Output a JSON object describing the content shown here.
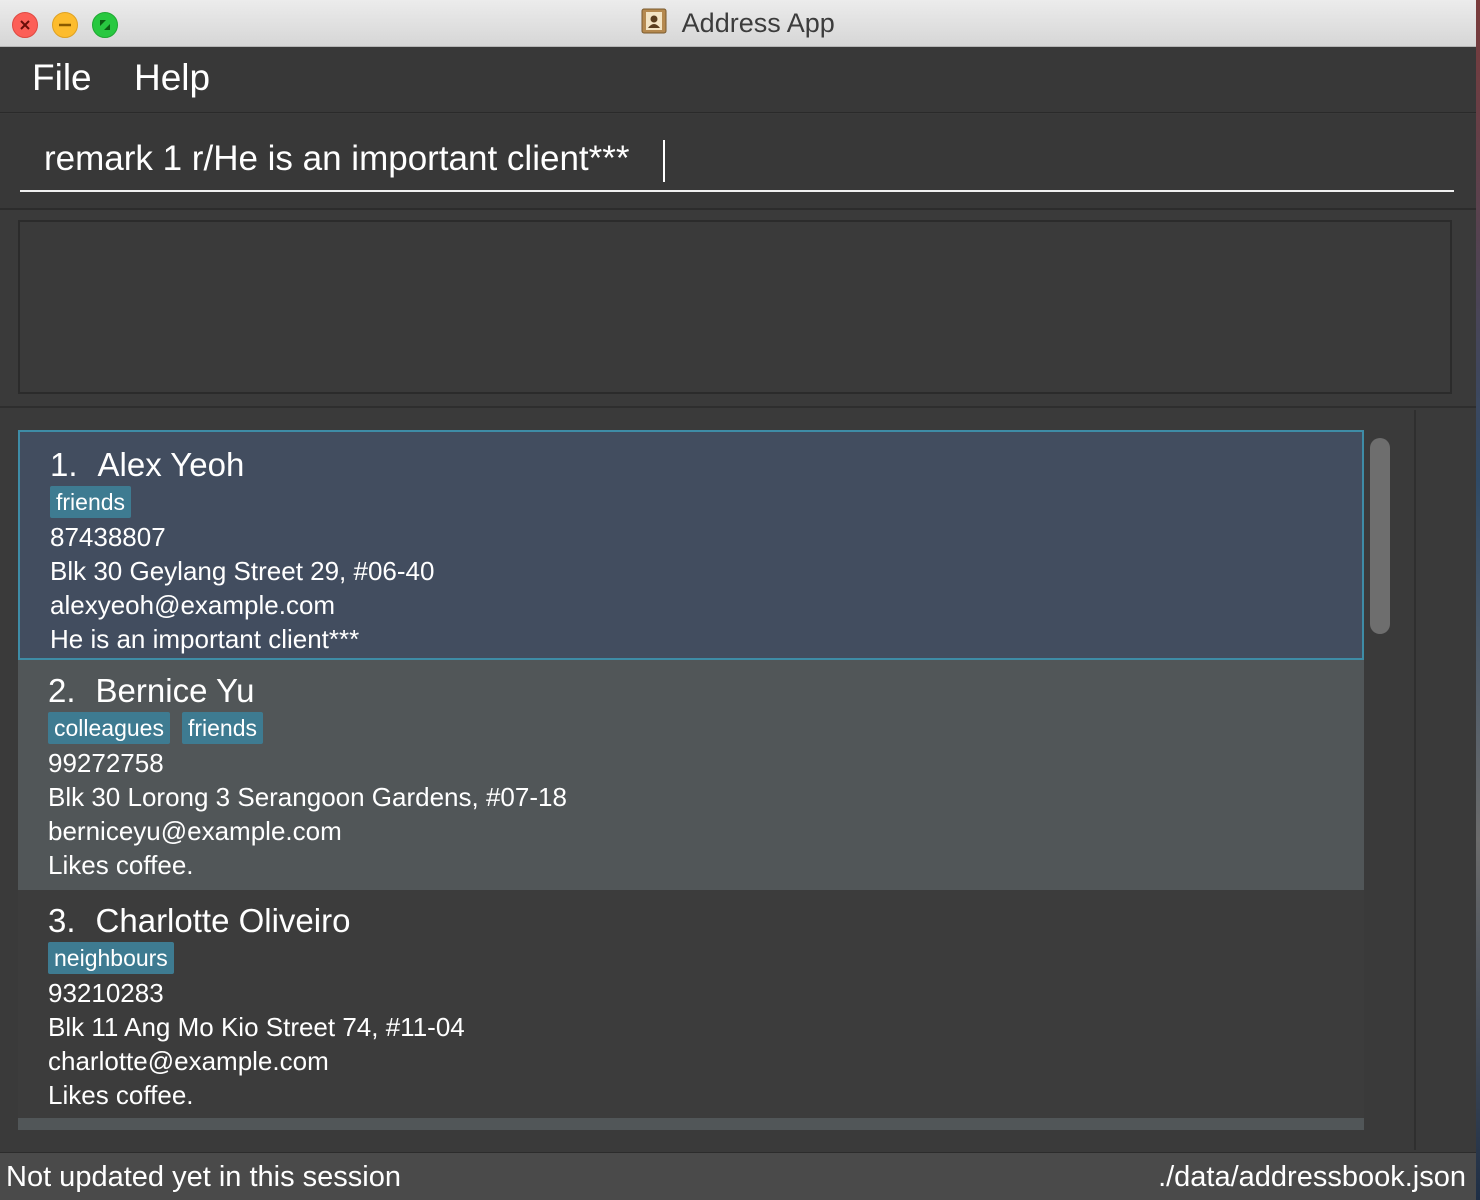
{
  "window": {
    "title": "Address App",
    "app_icon": "address-book-icon"
  },
  "menu": {
    "file": "File",
    "help": "Help"
  },
  "command": {
    "value": "remark 1 r/He is an important client***"
  },
  "result": {
    "text": ""
  },
  "persons": [
    {
      "index": "1.",
      "name": "Alex Yeoh",
      "tags": [
        "friends"
      ],
      "phone": "87438807",
      "address": "Blk 30 Geylang Street 29, #06-40",
      "email": "alexyeoh@example.com",
      "remark": "He is an important client***",
      "selected": true
    },
    {
      "index": "2.",
      "name": "Bernice Yu",
      "tags": [
        "colleagues",
        "friends"
      ],
      "phone": "99272758",
      "address": "Blk 30 Lorong 3 Serangoon Gardens, #07-18",
      "email": "berniceyu@example.com",
      "remark": "Likes coffee."
    },
    {
      "index": "3.",
      "name": "Charlotte Oliveiro",
      "tags": [
        "neighbours"
      ],
      "phone": "93210283",
      "address": "Blk 11 Ang Mo Kio Street 74, #11-04",
      "email": "charlotte@example.com",
      "remark": "Likes coffee."
    }
  ],
  "status": {
    "sync": "Not updated yet in this session",
    "path": "./data/addressbook.json"
  },
  "colors": {
    "accent": "#3e8ca6",
    "tag": "#3e7b91",
    "selected_card": "#424d5f",
    "background": "#3a3a3a"
  }
}
